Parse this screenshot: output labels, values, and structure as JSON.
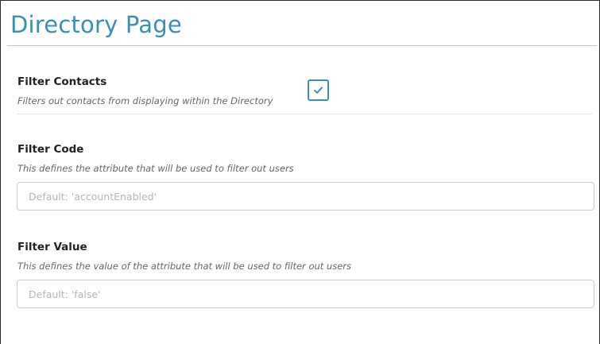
{
  "header": {
    "title": "Directory Page"
  },
  "settings": {
    "filter_contacts": {
      "label": "Filter Contacts",
      "description": "Filters out contacts from displaying within the Directory",
      "checked": true
    },
    "filter_code": {
      "label": "Filter Code",
      "description": "This defines the attribute that will be used to filter out users",
      "value": "",
      "placeholder": "Default: 'accountEnabled'"
    },
    "filter_value": {
      "label": "Filter Value",
      "description": "This defines the value of the attribute that will be used to filter out users",
      "value": "",
      "placeholder": "Default: 'false'"
    }
  },
  "colors": {
    "accent": "#3a8fb7"
  },
  "icons": {
    "checkbox": "checkmark-icon"
  }
}
